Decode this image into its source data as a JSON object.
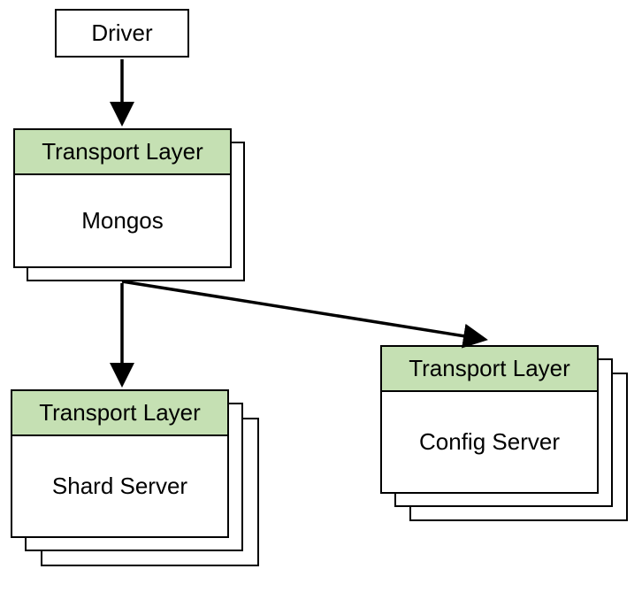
{
  "driver": {
    "label": "Driver"
  },
  "mongos": {
    "header": "Transport Layer",
    "body": "Mongos"
  },
  "shard": {
    "header": "Transport Layer",
    "body": "Shard Server"
  },
  "config": {
    "header": "Transport Layer",
    "body": "Config Server"
  },
  "colors": {
    "header_bg": "#c5e0b3",
    "border": "#000000"
  }
}
